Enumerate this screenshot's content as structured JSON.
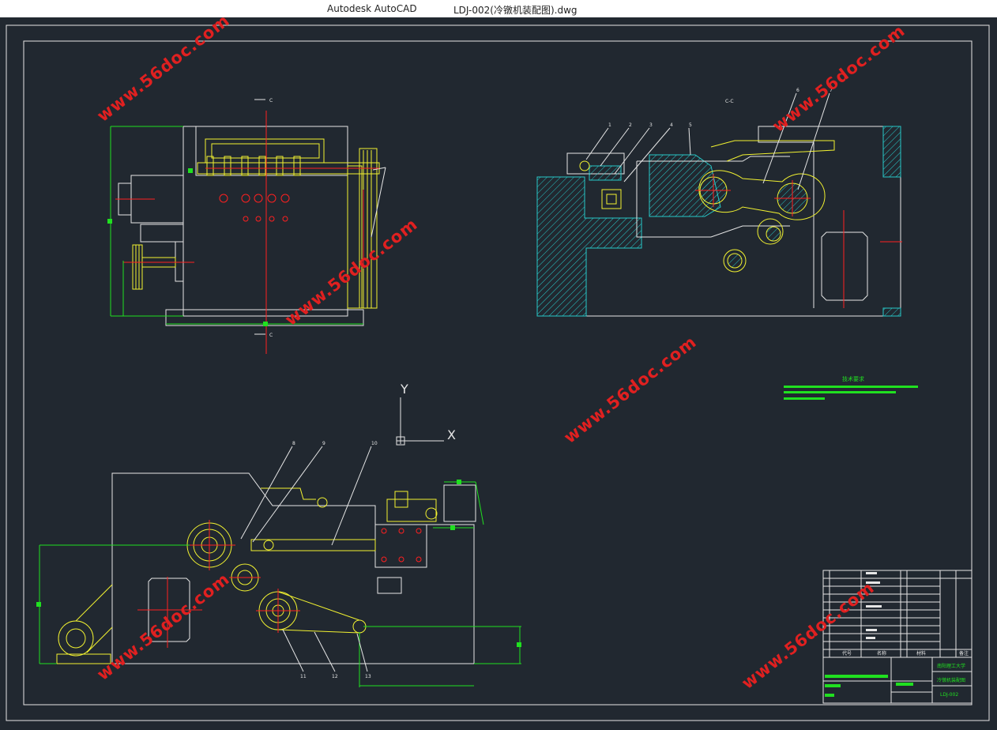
{
  "window": {
    "app_title": "Autodesk AutoCAD",
    "file_title": "LDJ-002(冷镦机装配图).dwg"
  },
  "drawing": {
    "section_label": "C-C",
    "cut_marker_top": "C",
    "cut_marker_bottom": "C",
    "ucs_x": "X",
    "ucs_y": "Y",
    "tech_req_title": "技术要求",
    "part_balloons_top": [
      "1",
      "2",
      "3",
      "4",
      "5",
      "6",
      "7"
    ],
    "part_balloons_bottom": [
      "8",
      "9",
      "10",
      "11",
      "12",
      "13"
    ]
  },
  "title_block": {
    "school": "南阳理工大学",
    "drawing_name": "冷镦机装配图",
    "drawing_number": "LDJ-002",
    "col_code": "代号",
    "col_name": "名称",
    "col_material": "材料",
    "col_remark": "备注"
  },
  "watermarks": [
    "www.56doc.com"
  ],
  "colors": {
    "background": "#212830",
    "line_white": "#e6e6e6",
    "line_yellow": "#f2f230",
    "line_green": "#20e020",
    "line_red": "#ff2020",
    "hatch_cyan": "#28c8c8",
    "watermark": "#e02020"
  }
}
